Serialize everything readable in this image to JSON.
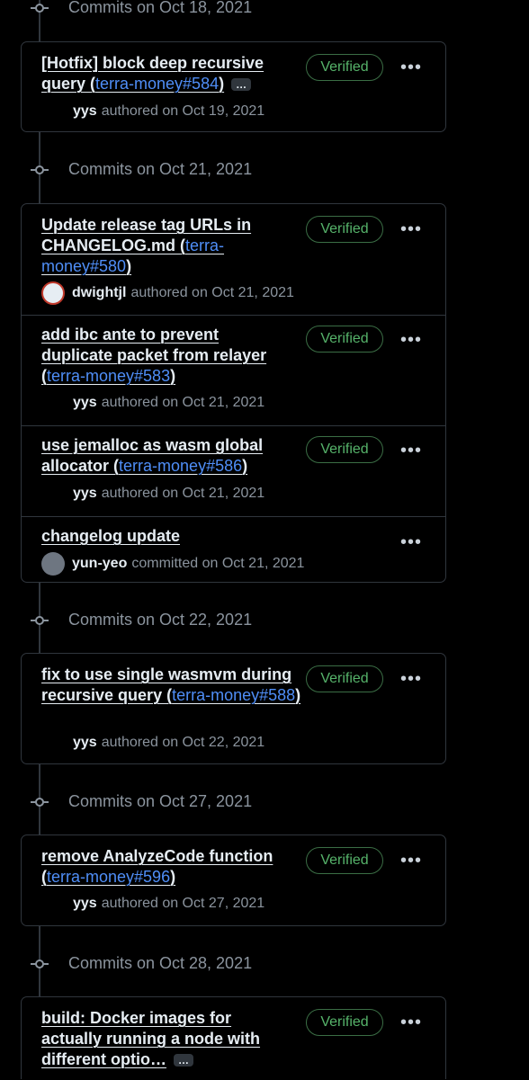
{
  "groups": [
    {
      "label": "Commits on Oct 18, 2021"
    },
    {
      "label": "Commits on Oct 21, 2021"
    },
    {
      "label": "Commits on Oct 22, 2021"
    },
    {
      "label": "Commits on Oct 27, 2021"
    },
    {
      "label": "Commits on Oct 28, 2021"
    }
  ],
  "verified_label": "Verified",
  "more_icon": "kebab-horizontal-icon",
  "expand_label": "…",
  "commits": [
    {
      "title_text": "[Hotfix] block deep recursive query (",
      "link": "terra-money#584",
      "title_end": ")",
      "author": "yys",
      "action": "authored on Oct 19, 2021"
    },
    {
      "title_text": "Update release tag URLs in CHANGELOG.md (",
      "link": "terra-money#580",
      "title_end": ")",
      "author": "dwightjl",
      "action": "authored on Oct 21, 2021"
    },
    {
      "title_text": "add ibc ante to prevent duplicate packet from relayer (",
      "link": "terra-money#583",
      "title_end": ")",
      "author": "yys",
      "action": "authored on Oct 21, 2021"
    },
    {
      "title_text": "use jemalloc as wasm global allocator (",
      "link": "terra-money#586",
      "title_end": ")",
      "author": "yys",
      "action": "authored on Oct 21, 2021"
    },
    {
      "title_text": "changelog update",
      "link": "",
      "title_end": "",
      "author": "yun-yeo",
      "action": "committed on Oct 21, 2021"
    },
    {
      "title_text": "fix to use single wasmvm during recursive query (",
      "link": "terra-money#588",
      "title_end": ")",
      "author": "yys",
      "action": "authored on Oct 22, 2021"
    },
    {
      "title_text": "remove AnalyzeCode function (",
      "link": "terra-money#596",
      "title_end": ")",
      "author": "yys",
      "action": "authored on Oct 27, 2021"
    },
    {
      "title_text": "build: Docker images for actually running a node with different optio…",
      "link": "",
      "title_end": "",
      "author": "",
      "action": ""
    }
  ],
  "colors": {
    "background": "#000000",
    "border": "#30363d",
    "link": "#4f8ef7",
    "verified": "#56b36a"
  }
}
